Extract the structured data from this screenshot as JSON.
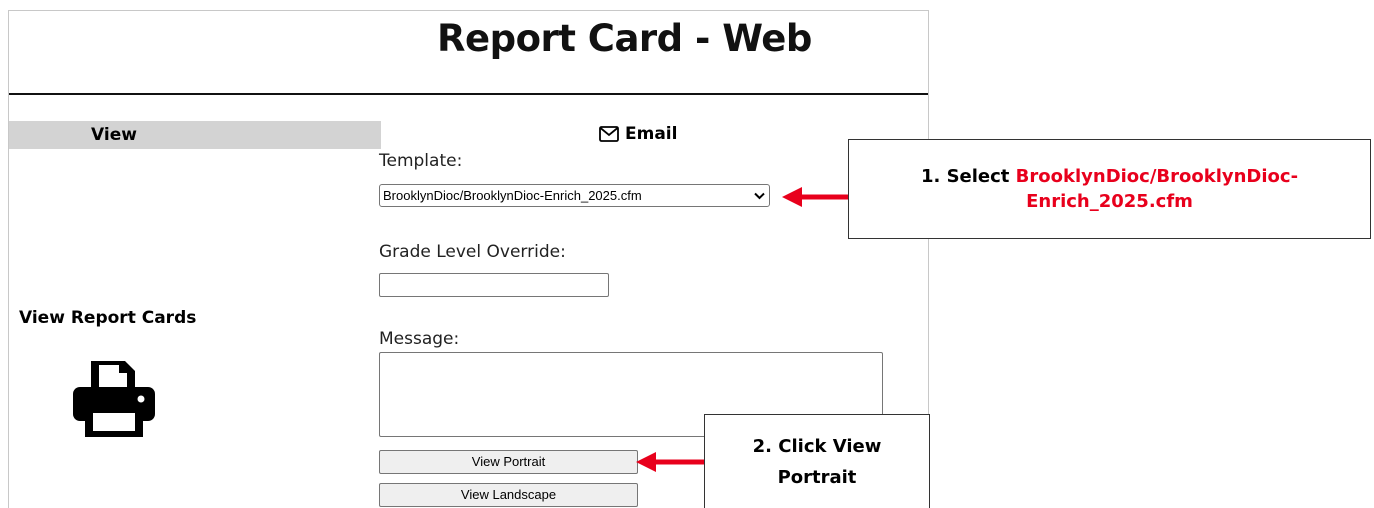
{
  "page": {
    "title": "Report Card - Web"
  },
  "left": {
    "view_header": "View",
    "view_report_cards_label": "View Report Cards",
    "printer_icon": "printer-icon"
  },
  "form": {
    "email_label": "Email",
    "email_icon": "envelope-icon",
    "template_label": "Template:",
    "template_value": "BrooklynDioc/BrooklynDioc-Enrich_2025.cfm",
    "grade_level_label": "Grade Level Override:",
    "grade_level_value": "",
    "message_label": "Message:",
    "message_value": "",
    "view_portrait_button": "View Portrait",
    "view_landscape_button": "View Landscape"
  },
  "annotations": {
    "step1_prefix": "1.  Select ",
    "step1_highlight_line1": "BrooklynDioc/BrooklynDioc-",
    "step1_highlight_line2": "Enrich_2025.cfm",
    "step2_line1": "2.  Click View",
    "step2_line2": "Portrait",
    "highlight_color": "#e8001c",
    "arrow_color": "#e8001c"
  }
}
